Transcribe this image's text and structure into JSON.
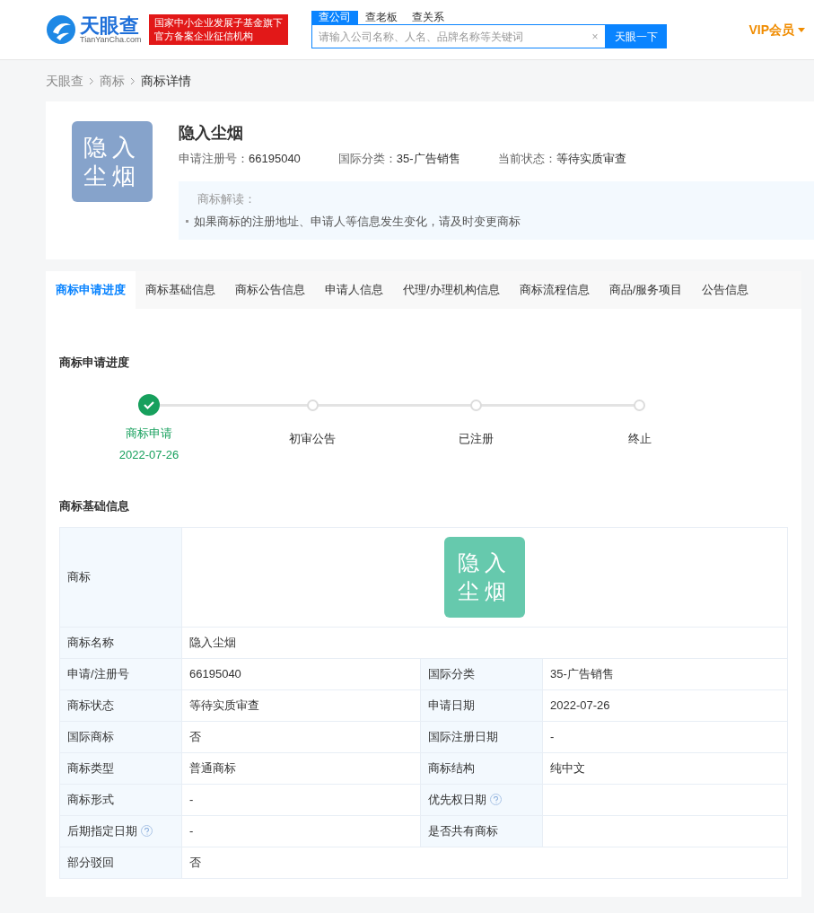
{
  "header": {
    "logo_text": "天眼查",
    "logo_sub": "TianYanCha.com",
    "badge_lines": [
      "国家中小企业发展子基金旗下",
      "官方备案企业征信机构"
    ],
    "search_tabs": [
      {
        "label": "查公司",
        "selected": true
      },
      {
        "label": "查老板",
        "selected": false
      },
      {
        "label": "查关系",
        "selected": false
      }
    ],
    "placeholder": "请输入公司名称、人名、品牌名称等关键词",
    "clear": "×",
    "button": "天眼一下",
    "vip": "VIP会员"
  },
  "breadcrumb": [
    "天眼查",
    "商标",
    "商标详情"
  ],
  "summary": {
    "logo_lines": [
      "隐入",
      "尘烟"
    ],
    "name": "隐入尘烟",
    "fields": [
      {
        "label": "申请注册号：",
        "value": "66195040"
      },
      {
        "label": "国际分类：",
        "value": "35-广告销售"
      },
      {
        "label": "当前状态：",
        "value": "等待实质审查"
      }
    ],
    "note_title": "商标解读：",
    "note_items": [
      "如果商标的注册地址、申请人等信息发生变化，请及时变更商标"
    ]
  },
  "tabs": [
    {
      "label": "商标申请进度",
      "selected": true
    },
    {
      "label": "商标基础信息",
      "selected": false
    },
    {
      "label": "商标公告信息",
      "selected": false
    },
    {
      "label": "申请人信息",
      "selected": false
    },
    {
      "label": "代理/办理机构信息",
      "selected": false
    },
    {
      "label": "商标流程信息",
      "selected": false
    },
    {
      "label": "商品/服务项目",
      "selected": false
    },
    {
      "label": "公告信息",
      "selected": false
    }
  ],
  "progress": {
    "title": "商标申请进度",
    "steps": [
      {
        "label": "商标申请",
        "date": "2022-07-26",
        "done": true
      },
      {
        "label": "初审公告",
        "done": false
      },
      {
        "label": "已注册",
        "done": false
      },
      {
        "label": "终止",
        "done": false
      }
    ]
  },
  "basic_info": {
    "title": "商标基础信息",
    "rows": [
      [
        {
          "label": "商标",
          "kind": "logo",
          "logo_lines": [
            "隐入",
            "尘烟"
          ]
        }
      ],
      [
        {
          "label": "商标名称",
          "kind": "text",
          "value": "隐入尘烟"
        }
      ],
      [
        {
          "label": "申请/注册号",
          "kind": "text",
          "value": "66195040"
        },
        {
          "label": "国际分类",
          "kind": "text",
          "value": "35-广告销售"
        }
      ],
      [
        {
          "label": "商标状态",
          "kind": "text",
          "value": "等待实质审查"
        },
        {
          "label": "申请日期",
          "kind": "text",
          "value": "2022-07-26"
        }
      ],
      [
        {
          "label": "国际商标",
          "kind": "text",
          "value": "否"
        },
        {
          "label": "国际注册日期",
          "kind": "text",
          "value": "-"
        }
      ],
      [
        {
          "label": "商标类型",
          "kind": "text",
          "value": "普通商标"
        },
        {
          "label": "商标结构",
          "kind": "text",
          "value": "纯中文"
        }
      ],
      [
        {
          "label": "商标形式",
          "kind": "text",
          "value": "-"
        },
        {
          "label": "优先权日期",
          "kind": "text",
          "help": true
        }
      ],
      [
        {
          "label": "后期指定日期",
          "kind": "text",
          "value": "-",
          "help": true
        },
        {
          "label": "是否共有商标",
          "kind": "text"
        }
      ],
      [
        {
          "label": "部分驳回",
          "kind": "text",
          "value": "否"
        }
      ]
    ]
  }
}
